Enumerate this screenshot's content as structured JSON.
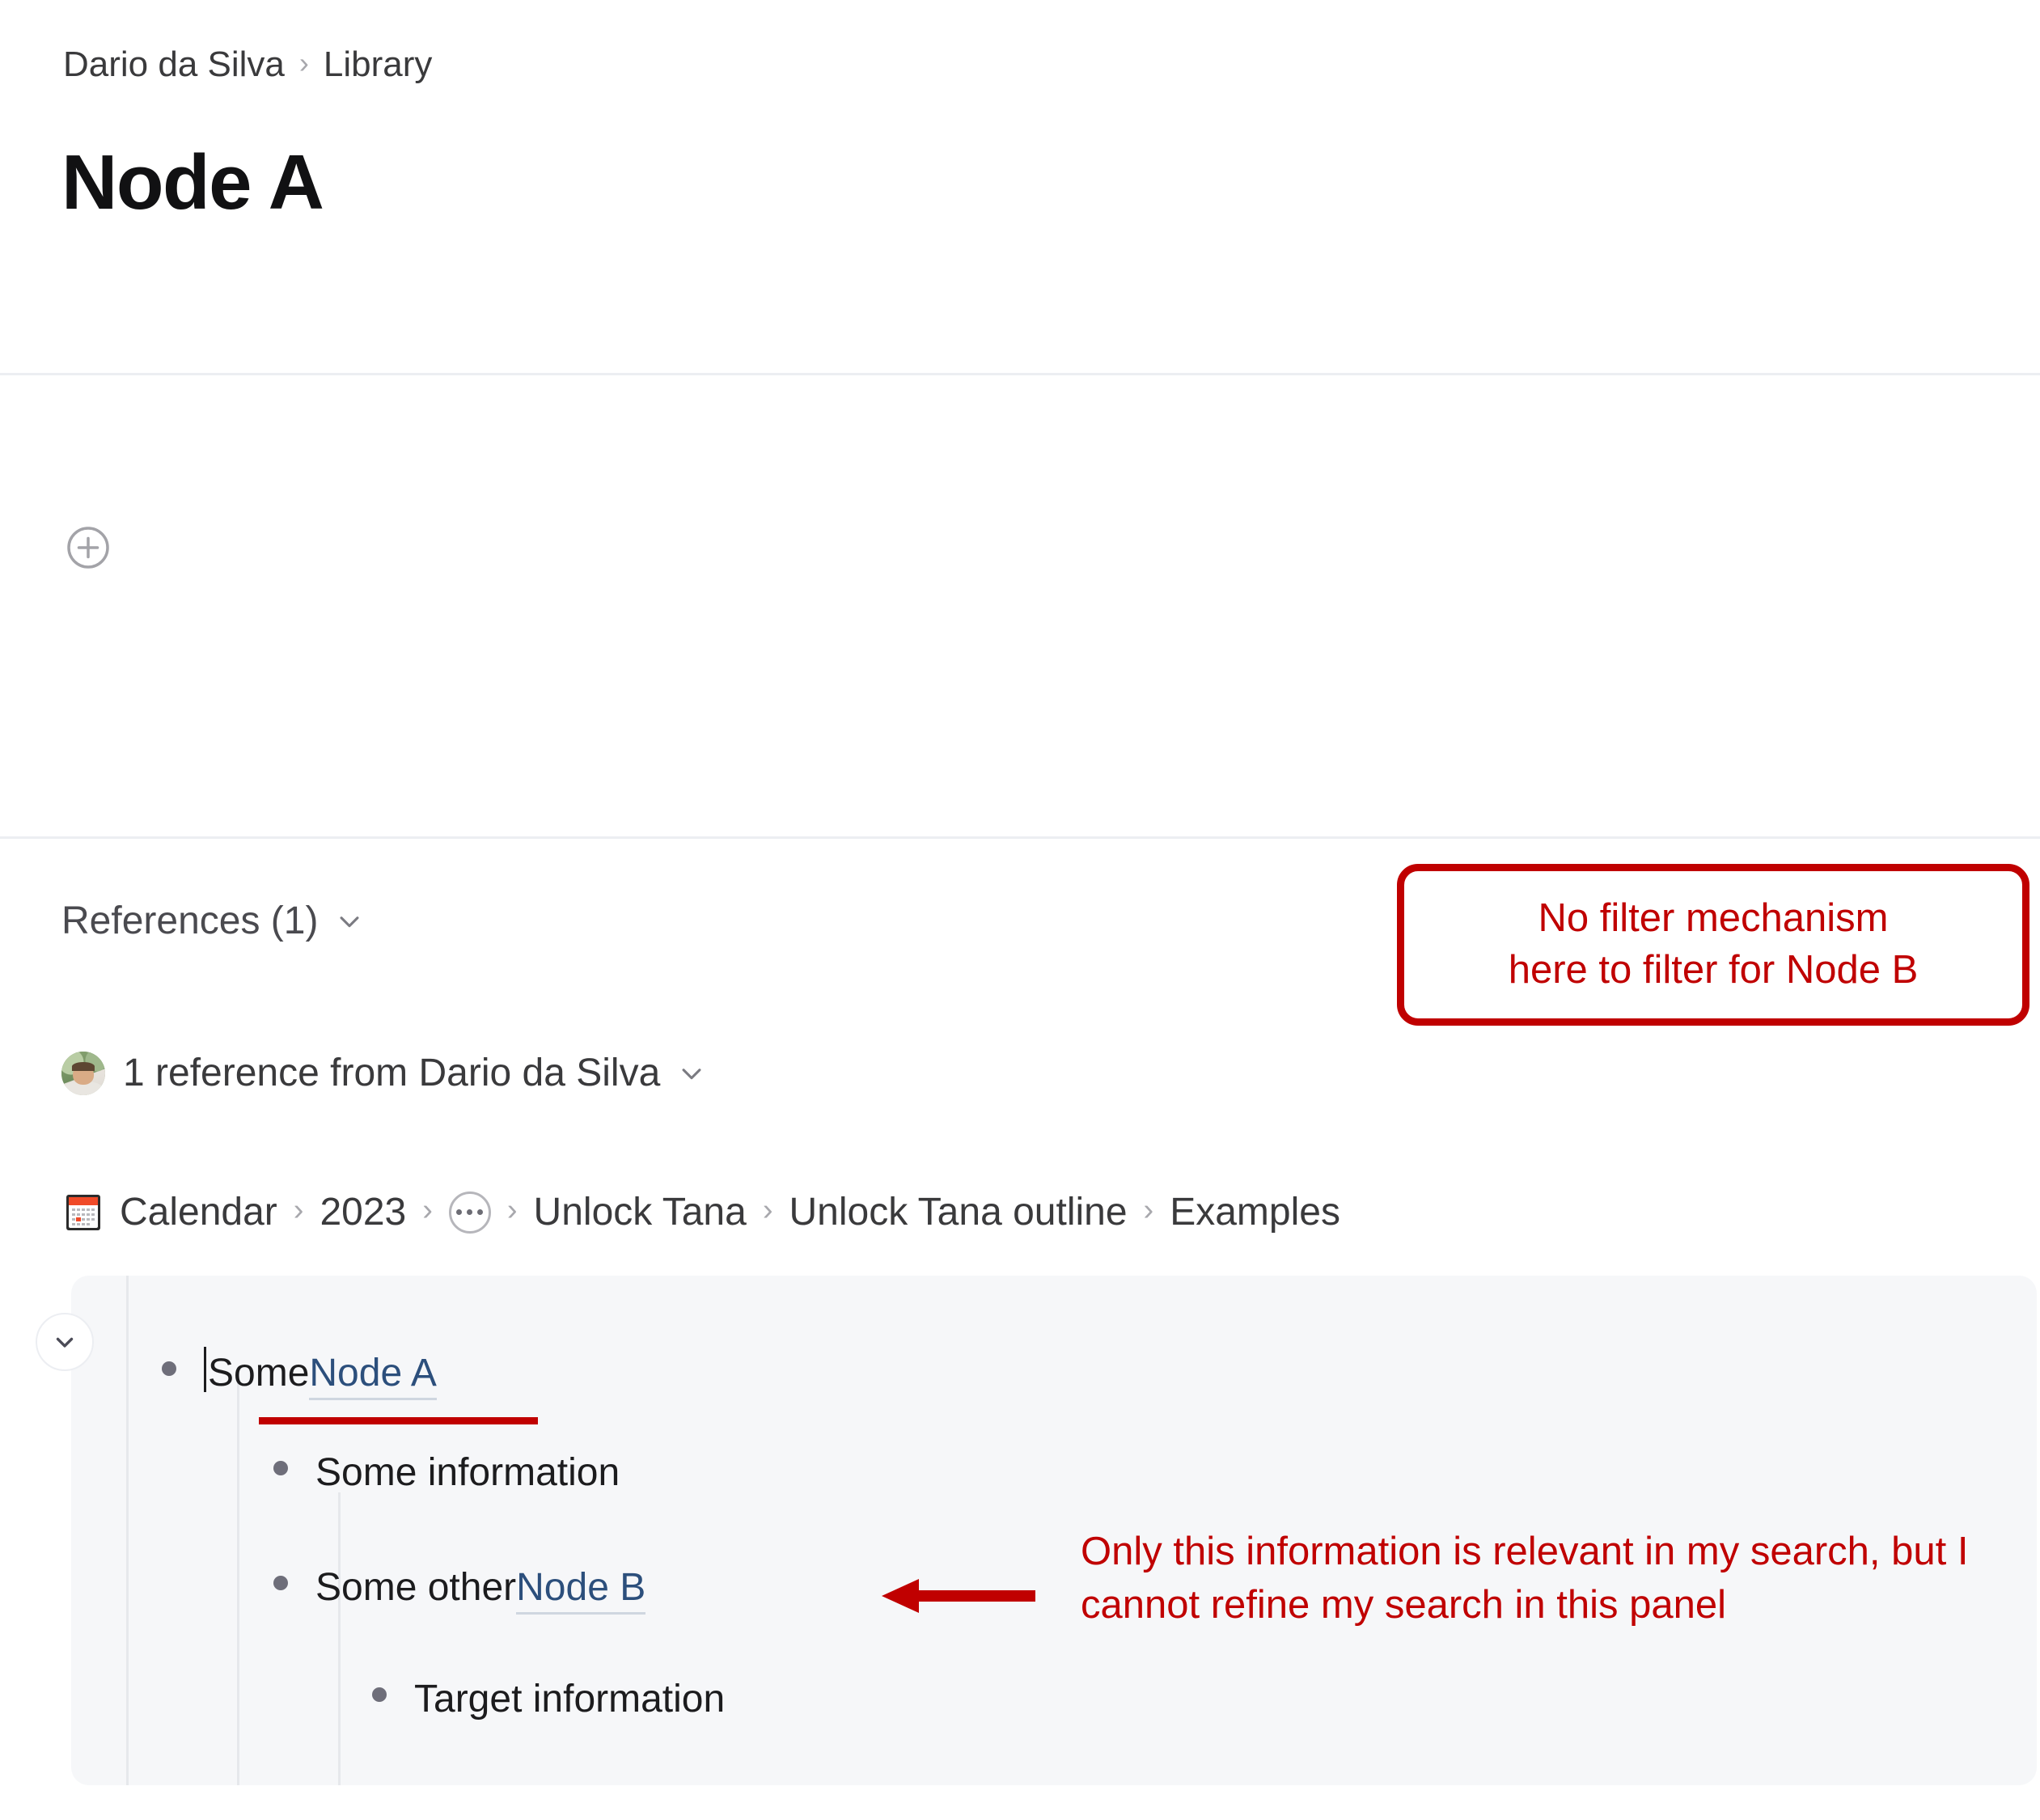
{
  "breadcrumb": {
    "items": [
      "Dario da Silva",
      "Library"
    ],
    "separator": "›"
  },
  "page": {
    "title": "Node A"
  },
  "content": {
    "add_node_icon": "plus-circle-icon"
  },
  "references": {
    "header_label": "References (1)",
    "header_chevron": "chevron-down-icon",
    "group_label": "1 reference from Dario da Silva",
    "group_chevron": "chevron-down-icon",
    "avatar_name": "Dario da Silva",
    "source_breadcrumb": {
      "calendar_icon": "calendar-icon",
      "items": [
        "Calendar",
        "2023",
        "…",
        "Unlock Tana",
        "Unlock Tana outline",
        "Examples"
      ],
      "ellipsis_icon": "more-dots-icon",
      "separator": "›"
    },
    "outline": {
      "collapse_icon": "chevron-down-icon",
      "rows": [
        {
          "plain": "Some ",
          "ref": "Node A",
          "struck": false
        },
        {
          "plain": "Some information",
          "ref": "",
          "struck": true
        },
        {
          "plain": "Some other ",
          "ref": "Node B",
          "struck": false
        },
        {
          "plain": "Target information",
          "ref": "",
          "struck": false
        }
      ]
    }
  },
  "annotations": {
    "color": "#c00000",
    "box_text_line1": "No filter mechanism",
    "box_text_line2": "here to filter for Node B",
    "callout_text": "Only this information is relevant in my search, but I cannot refine my search in this panel",
    "arrow_icon": "left-arrow-icon",
    "strikethrough_icon": "strikethrough-line"
  }
}
